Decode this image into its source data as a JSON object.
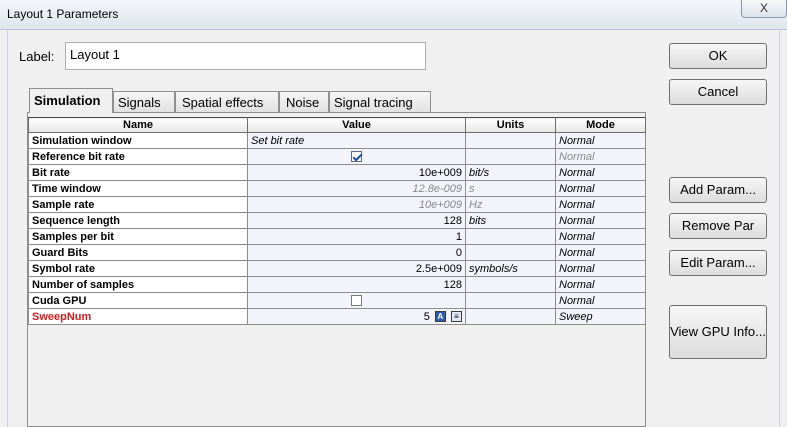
{
  "window": {
    "title": "Layout 1 Parameters",
    "close_label": "X"
  },
  "label_field": {
    "caption": "Label:",
    "value": "Layout 1"
  },
  "tabs": [
    {
      "label": "Simulation",
      "active": true
    },
    {
      "label": "Signals"
    },
    {
      "label": "Spatial effects"
    },
    {
      "label": "Noise"
    },
    {
      "label": "Signal tracing"
    }
  ],
  "grid": {
    "headers": {
      "name": "Name",
      "value": "Value",
      "units": "Units",
      "mode": "Mode"
    },
    "rows": [
      {
        "name": "Simulation window",
        "value": "Set bit rate",
        "units": "",
        "mode": "Normal"
      },
      {
        "name": "Reference bit rate",
        "value": "",
        "units": "",
        "mode": "Normal",
        "checkbox": true
      },
      {
        "name": "Bit rate",
        "value": "10e+009",
        "units": "bit/s",
        "mode": "Normal"
      },
      {
        "name": "Time window",
        "value": "12.8e-009",
        "units": "s",
        "mode": "Normal"
      },
      {
        "name": "Sample rate",
        "value": "10e+009",
        "units": "Hz",
        "mode": "Normal"
      },
      {
        "name": "Sequence length",
        "value": "128",
        "units": "bits",
        "mode": "Normal"
      },
      {
        "name": "Samples per bit",
        "value": "1",
        "units": "",
        "mode": "Normal"
      },
      {
        "name": "Guard Bits",
        "value": "0",
        "units": "",
        "mode": "Normal"
      },
      {
        "name": "Symbol rate",
        "value": "2.5e+009",
        "units": "symbols/s",
        "mode": "Normal"
      },
      {
        "name": "Number of samples",
        "value": "128",
        "units": "",
        "mode": "Normal"
      },
      {
        "name": "Cuda GPU",
        "value": "",
        "units": "",
        "mode": "Normal",
        "checkbox": false
      },
      {
        "name": "SweepNum",
        "value": "5",
        "units": "",
        "mode": "Sweep"
      }
    ]
  },
  "buttons": {
    "ok": "OK",
    "cancel": "Cancel",
    "add_param": "Add Param...",
    "remove_param": "Remove Par",
    "edit_param": "Edit Param...",
    "view_gpu": "View GPU Info..."
  },
  "sweep_icons": {
    "a_label": "A",
    "list_label": "≡"
  },
  "colors": {
    "sweep_name": "#d01c1c",
    "check_accent": "#1c4fa6"
  }
}
